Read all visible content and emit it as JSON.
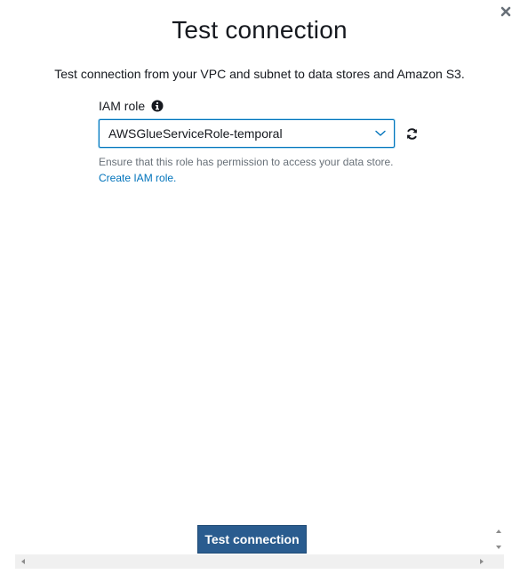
{
  "dialog": {
    "title": "Test connection",
    "description": "Test connection from your VPC and subnet to data stores and Amazon S3.",
    "close_icon": "close-icon"
  },
  "iam_role": {
    "label": "IAM role",
    "info_icon": "info-icon",
    "selected_value": "AWSGlueServiceRole-temporal",
    "dropdown_icon": "chevron-down-icon",
    "refresh_icon": "refresh-icon",
    "hint_text": "Ensure that this role has permission to access your data store.",
    "create_link": "Create IAM role."
  },
  "footer": {
    "test_button_label": "Test connection"
  },
  "colors": {
    "primary_button": "#2a5c8f",
    "link": "#0073bb",
    "focus_border": "#0073bb",
    "hint_text": "#687078"
  }
}
